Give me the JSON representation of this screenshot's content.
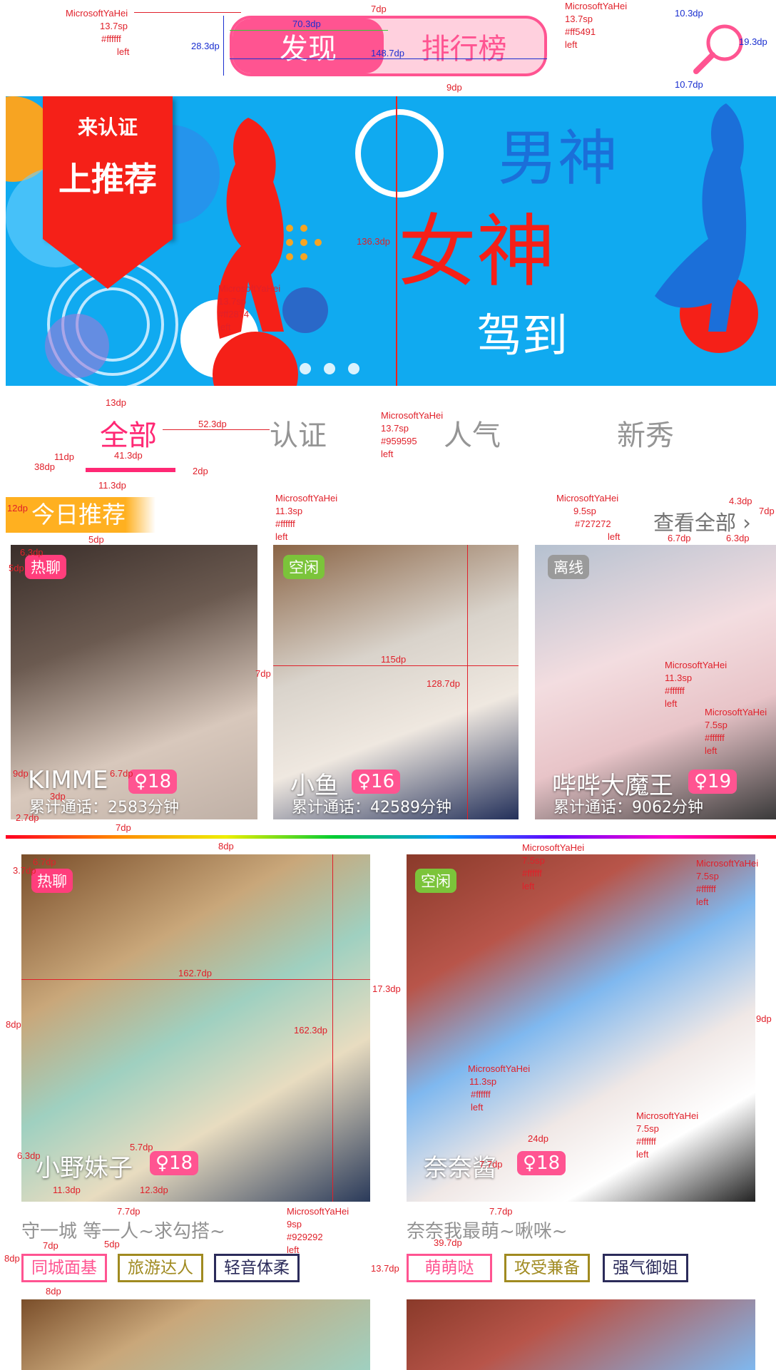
{
  "top_tabs": {
    "discover": "发现",
    "ranking": "排行榜"
  },
  "banner": {
    "tag_line1": "来认证",
    "tag_line2": "上推荐",
    "headline1": "男神",
    "headline2": "女神",
    "headline3": "驾到"
  },
  "categories": [
    "全部",
    "认证",
    "人气",
    "新秀"
  ],
  "today": {
    "title": "今日推荐",
    "view_all": "查看全部"
  },
  "today_cards": [
    {
      "status": "热聊",
      "name": "KIMME",
      "age": "18",
      "total": "累计通话：2583分钟",
      "colors": [
        "#3a2e2a",
        "#c9b9ae"
      ]
    },
    {
      "status": "空闲",
      "name": "小鱼",
      "age": "16",
      "total": "累计通话：42589分钟",
      "colors": [
        "#a47c5a",
        "#e2ddd6"
      ]
    },
    {
      "status": "离线",
      "name": "哔哔大魔王",
      "age": "19",
      "total": "累计通话：9062分钟",
      "colors": [
        "#c0c9d6",
        "#f3d7dc"
      ]
    }
  ],
  "feed_cards": [
    {
      "status": "热聊",
      "name": "小野妹子",
      "age": "18",
      "motto": "守一城 等一人~求勾搭~",
      "tags": [
        "同城面基",
        "旅游达人",
        "轻音体柔"
      ],
      "colors": [
        "#9a6a3a",
        "#d7c4a0"
      ]
    },
    {
      "status": "空闲",
      "name": "奈奈酱",
      "age": "18",
      "motto": "奈奈我最萌~啾咪~",
      "tags": [
        "萌萌哒",
        "攻受兼备",
        "强气御姐"
      ],
      "colors": [
        "#9a4a3a",
        "#dfe6f2"
      ]
    }
  ],
  "annotations": {
    "font_a": "MicrosoftYaHei",
    "sp_137": "13.7sp",
    "white": "#ffffff",
    "left": "left",
    "pink": "#ff5491",
    "red": "#ff2874",
    "gray95": "#959595",
    "sp_113": "11.3sp",
    "sp_95": "9.5sp",
    "gray72": "#727272",
    "sp_75": "7.5sp",
    "sp_9": "9sp",
    "gray92": "#929292",
    "d_283": "28.3dp",
    "d_703": "70.3dp",
    "d_1487": "148.7dp",
    "d_7": "7dp",
    "d_103a": "10.3dp",
    "d_193": "19.3dp",
    "d_107": "10.7dp",
    "d_9": "9dp",
    "d_1363": "136.3dp",
    "d_13": "13dp",
    "d_523": "52.3dp",
    "d_11": "11dp",
    "d_413": "41.3dp",
    "d_38": "38dp",
    "d_2": "2dp",
    "d_113": "11.3dp",
    "d_12": "12dp",
    "d_5": "5dp",
    "d_43": "4.3dp",
    "d_67": "6.7dp",
    "d_63": "6.3dp",
    "d_115": "115dp",
    "d_1287": "128.7dp",
    "d_3": "3dp",
    "d_27": "2.7dp",
    "d_8": "8dp",
    "d_37": "3.7dp",
    "d_1627": "162.7dp",
    "d_1623": "162.3dp",
    "d_173": "17.3dp",
    "d_57": "5.7dp",
    "d_123": "12.3dp",
    "d_77": "7.7dp",
    "d_24": "24dp",
    "d_397": "39.7dp",
    "d_137": "13.7dp"
  }
}
